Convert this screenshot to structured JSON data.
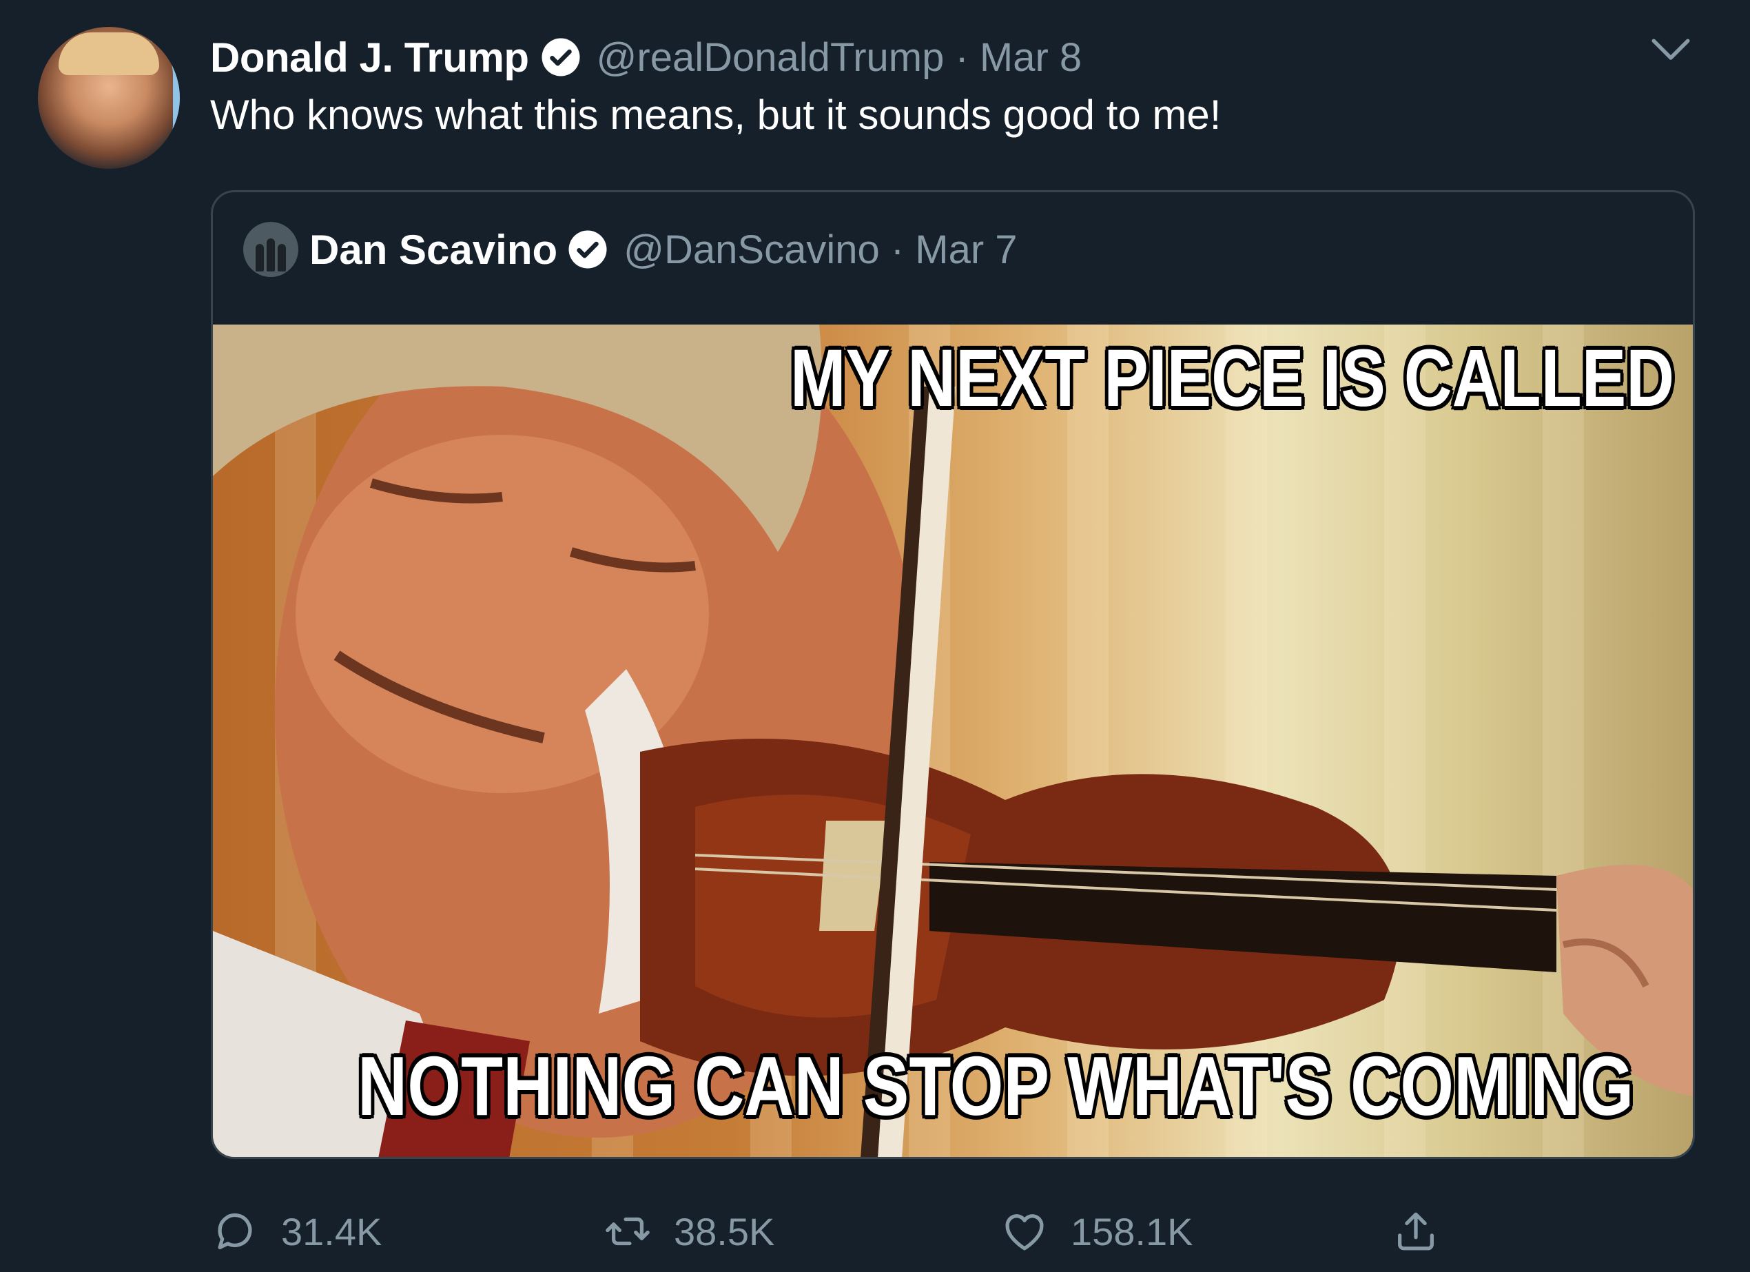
{
  "tweet": {
    "author_name": "Donald J. Trump",
    "author_handle_date": "@realDonaldTrump · Mar 8",
    "text": "Who knows what this means, but it sounds good to me!"
  },
  "quoted": {
    "author_name": "Dan Scavino",
    "author_handle_date": "@DanScavino · Mar 7",
    "meme_top_text": "MY NEXT PIECE IS CALLED",
    "meme_bottom_text": "NOTHING CAN STOP WHAT'S COMING"
  },
  "actions": {
    "reply_count": "31.4K",
    "retweet_count": "38.5K",
    "like_count": "158.1K"
  },
  "icons": {
    "verified": "verified-badge-icon",
    "chevron": "chevron-down-icon",
    "reply": "reply-icon",
    "retweet": "retweet-icon",
    "like": "heart-icon",
    "share": "share-icon"
  },
  "colors": {
    "background": "#15202b",
    "secondary_text": "#8899a6",
    "border": "#38444d"
  }
}
